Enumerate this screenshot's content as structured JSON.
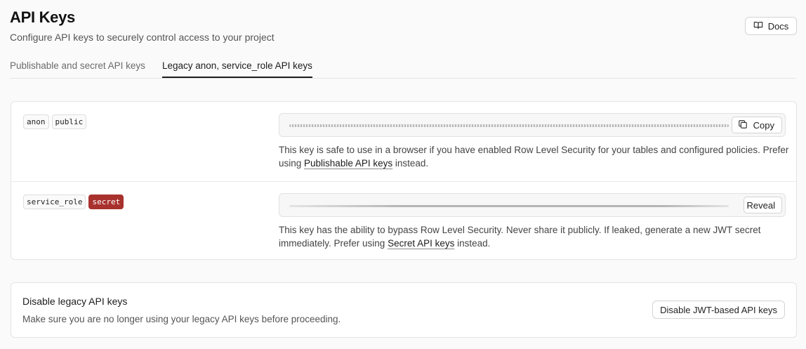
{
  "header": {
    "title": "API Keys",
    "subtitle": "Configure API keys to securely control access to your project",
    "docs_label": "Docs"
  },
  "tabs": [
    {
      "label": "Publishable and secret API keys",
      "active": false
    },
    {
      "label": "Legacy anon, service_role API keys",
      "active": true
    }
  ],
  "keys": {
    "anon": {
      "tags": [
        "anon",
        "public"
      ],
      "copy_label": "Copy",
      "desc_before": "This key is safe to use in a browser if you have enabled Row Level Security for your tables and configured policies. Prefer using ",
      "desc_link": "Publishable API keys",
      "desc_after": " instead."
    },
    "service_role": {
      "tags": [
        "service_role",
        "secret"
      ],
      "reveal_label": "Reveal",
      "desc_before": "This key has the ability to bypass Row Level Security. Never share it publicly. If leaked, generate a new JWT secret immediately. Prefer using ",
      "desc_link": "Secret API keys",
      "desc_after": " instead."
    }
  },
  "disable": {
    "title": "Disable legacy API keys",
    "description": "Make sure you are no longer using your legacy API keys before proceeding.",
    "button_label": "Disable JWT-based API keys"
  },
  "colors": {
    "secret_tag": "#a8312d",
    "active_tab_underline": "#1c1c1c"
  },
  "icons": {
    "docs": "book-open-icon",
    "copy": "copy-icon"
  }
}
